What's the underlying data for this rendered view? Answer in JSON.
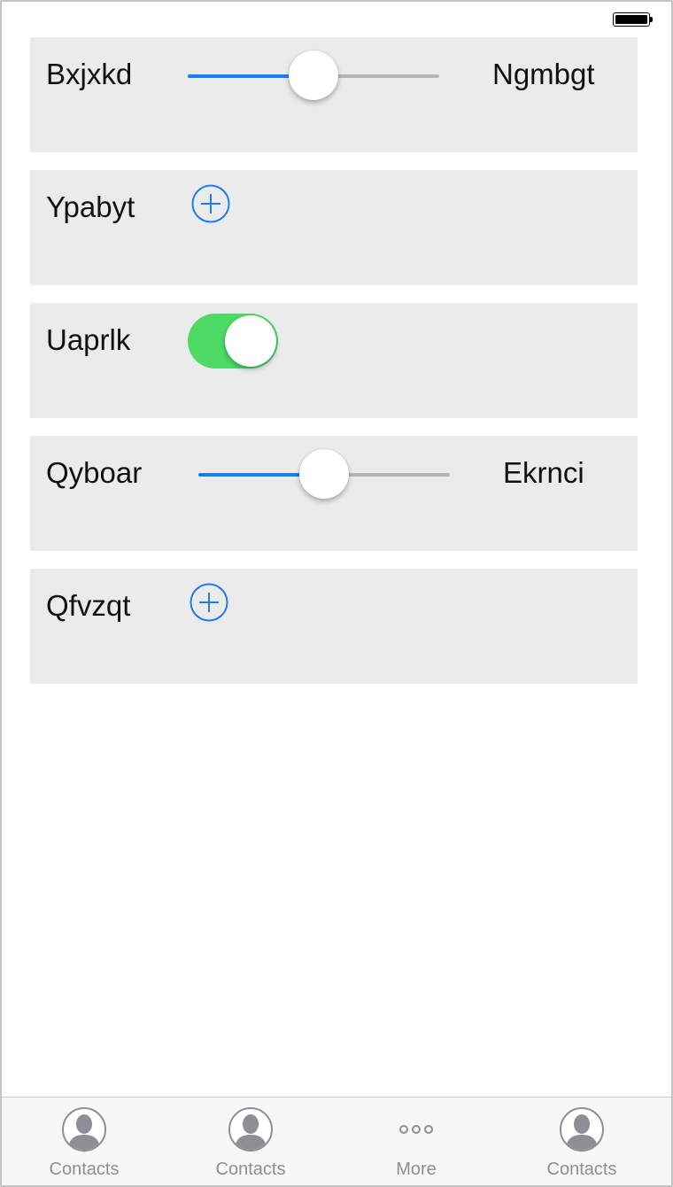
{
  "status_bar": {
    "battery_icon": "battery-full-icon"
  },
  "rows": [
    {
      "type": "slider",
      "label": "Bxjxkd",
      "right_label": "Ngmbgt",
      "value_fraction": 0.5
    },
    {
      "type": "add",
      "label": "Ypabyt",
      "icon": "add-circle-icon"
    },
    {
      "type": "toggle",
      "label": "Uaprlk",
      "on": true
    },
    {
      "type": "slider",
      "label": "Qyboar",
      "right_label": "Ekrnci",
      "value_fraction": 0.5
    },
    {
      "type": "add",
      "label": "Qfvzqt",
      "icon": "add-circle-icon"
    }
  ],
  "tabs": [
    {
      "label": "Contacts",
      "icon": "contact-icon"
    },
    {
      "label": "Contacts",
      "icon": "contact-icon"
    },
    {
      "label": "More",
      "icon": "more-icon"
    },
    {
      "label": "Contacts",
      "icon": "contact-icon"
    }
  ],
  "colors": {
    "accent": "#1a7df0",
    "toggle_on": "#4cd964",
    "row_background": "#ebebeb",
    "tab_label": "#8e8e93"
  }
}
